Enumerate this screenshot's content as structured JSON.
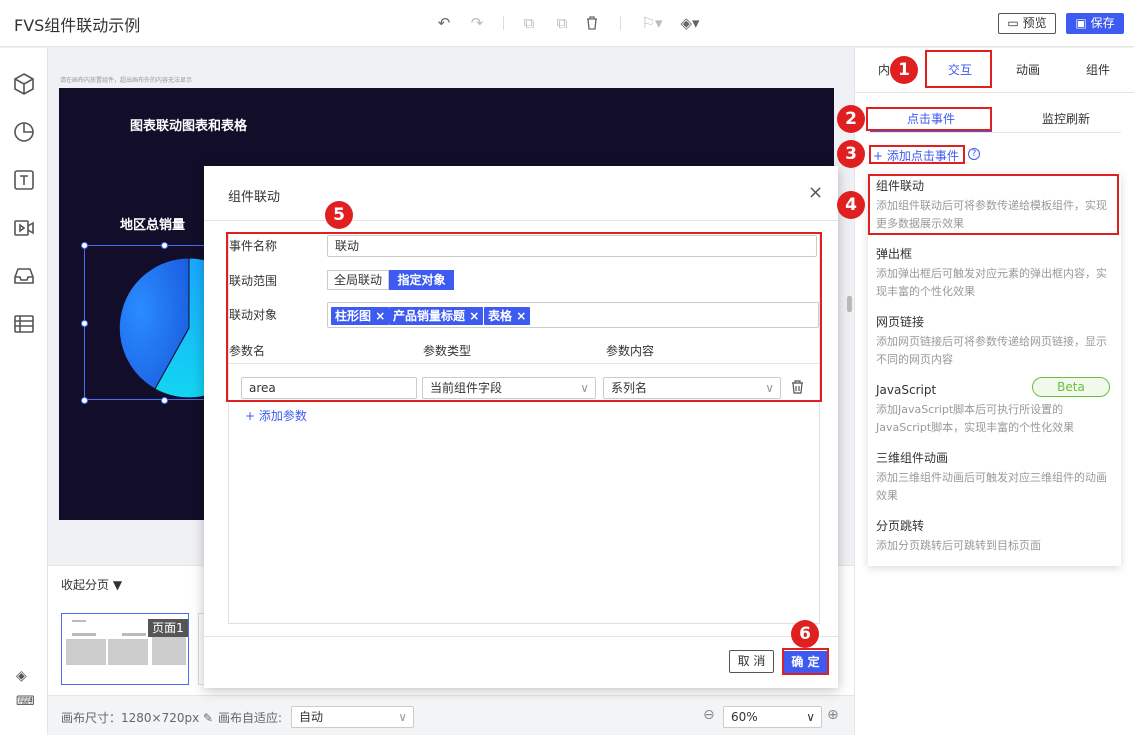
{
  "app": {
    "title": "FVS组件联动示例"
  },
  "toolbar": {
    "preview_label": "预览",
    "save_label": "保存"
  },
  "canvas": {
    "hint": "请在画布内放置组件，超出画布外的内容无法显示",
    "title": "图表联动图表和表格",
    "pie_title": "地区总销量"
  },
  "pages_panel": {
    "collapse_label": "收起分页",
    "thumb_label": "页面1"
  },
  "bottom": {
    "canvas_size": "画布尺寸：1280×720px",
    "adapt_label": "画布自适应:",
    "adapt_value": "自动",
    "zoom_value": "60%"
  },
  "right_panel": {
    "tabs": [
      "内容",
      "交互",
      "动画",
      "组件"
    ],
    "subtabs": [
      "点击事件",
      "监控刷新"
    ],
    "add_event_label": "+ 添加点击事件",
    "menu": [
      {
        "title": "组件联动",
        "desc": "添加组件联动后可将参数传递给模板组件，实现更多数据展示效果"
      },
      {
        "title": "弹出框",
        "desc": "添加弹出框后可触发对应元素的弹出框内容，实现丰富的个性化效果"
      },
      {
        "title": "网页链接",
        "desc": "添加网页链接后可将参数传递给网页链接，显示不同的网页内容"
      },
      {
        "title": "JavaScript",
        "desc": "添加JavaScript脚本后可执行所设置的JavaScript脚本，实现丰富的个性化效果"
      },
      {
        "title": "三维组件动画",
        "desc": "添加三维组件动画后可触发对应三维组件的动画效果"
      },
      {
        "title": "分页跳转",
        "desc": "添加分页跳转后可跳转到目标页面"
      }
    ],
    "beta_label": "Beta"
  },
  "dialog": {
    "title": "组件联动",
    "event_name_label": "事件名称",
    "event_name_value": "联动",
    "scope_label": "联动范围",
    "scope_options": [
      "全局联动",
      "指定对象"
    ],
    "target_label": "联动对象",
    "targets": [
      "柱形图",
      "产品销量标题",
      "表格"
    ],
    "param_headers": [
      "参数名",
      "参数类型",
      "参数内容"
    ],
    "param_row": {
      "name": "area",
      "type": "当前组件字段",
      "content": "系列名"
    },
    "add_param_label": "+ 添加参数",
    "cancel_label": "取 消",
    "ok_label": "确 定"
  },
  "annotations": [
    "1",
    "2",
    "3",
    "4",
    "5",
    "6"
  ],
  "colors": {
    "accent": "#3d5af1",
    "highlight": "#e02020",
    "canvas_bg": "#120e2a",
    "beta": "#67c23a"
  }
}
